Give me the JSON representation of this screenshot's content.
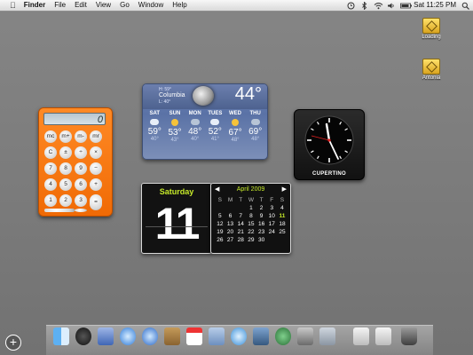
{
  "menubar": {
    "app": "Finder",
    "menus": [
      "File",
      "Edit",
      "View",
      "Go",
      "Window",
      "Help"
    ],
    "clock": "Sat 11:25 PM"
  },
  "desktop_icons": [
    {
      "label": "Loading"
    },
    {
      "label": "Antonia"
    }
  ],
  "calculator": {
    "display": "0"
  },
  "weather": {
    "hi": "H: 59°",
    "city": "Columbia",
    "lo": "L: 40°",
    "current": "44°",
    "days": [
      {
        "day": "SAT",
        "hi": "59°",
        "lo": "40°",
        "icon": "cloud-icon"
      },
      {
        "day": "SUN",
        "hi": "53°",
        "lo": "43°",
        "icon": "sun-icon"
      },
      {
        "day": "MON",
        "hi": "48°",
        "lo": "40°",
        "icon": "rain-icon"
      },
      {
        "day": "TUES",
        "hi": "52°",
        "lo": "41°",
        "icon": "cloud-icon"
      },
      {
        "day": "WED",
        "hi": "67°",
        "lo": "48°",
        "icon": "sun-icon"
      },
      {
        "day": "THU",
        "hi": "69°",
        "lo": "48°",
        "icon": "rain-icon"
      }
    ]
  },
  "clock_widget": {
    "city": "CUPERTINO",
    "time": "11:25"
  },
  "day_widget": {
    "day_name": "Saturday",
    "day_num": "11"
  },
  "calendar": {
    "month": "April 2009",
    "dow": [
      "S",
      "M",
      "T",
      "W",
      "T",
      "F",
      "S"
    ],
    "weeks": [
      [
        "",
        "",
        "",
        "1",
        "2",
        "3",
        "4"
      ],
      [
        "5",
        "6",
        "7",
        "8",
        "9",
        "10",
        "11"
      ],
      [
        "12",
        "13",
        "14",
        "15",
        "16",
        "17",
        "18"
      ],
      [
        "19",
        "20",
        "21",
        "22",
        "23",
        "24",
        "25"
      ],
      [
        "26",
        "27",
        "28",
        "29",
        "30",
        "",
        ""
      ]
    ],
    "today": "11"
  },
  "dock": {
    "items": [
      "finder-icon",
      "dashboard-icon",
      "mail-icon",
      "safari-icon",
      "ichat-icon",
      "address-book-icon",
      "ical-icon",
      "preview-icon",
      "itunes-icon",
      "iphoto-icon",
      "time-machine-icon",
      "system-preferences-icon",
      "utilities-icon",
      "document-icon",
      "document-icon-2",
      "trash-icon"
    ],
    "add_button": "+"
  }
}
